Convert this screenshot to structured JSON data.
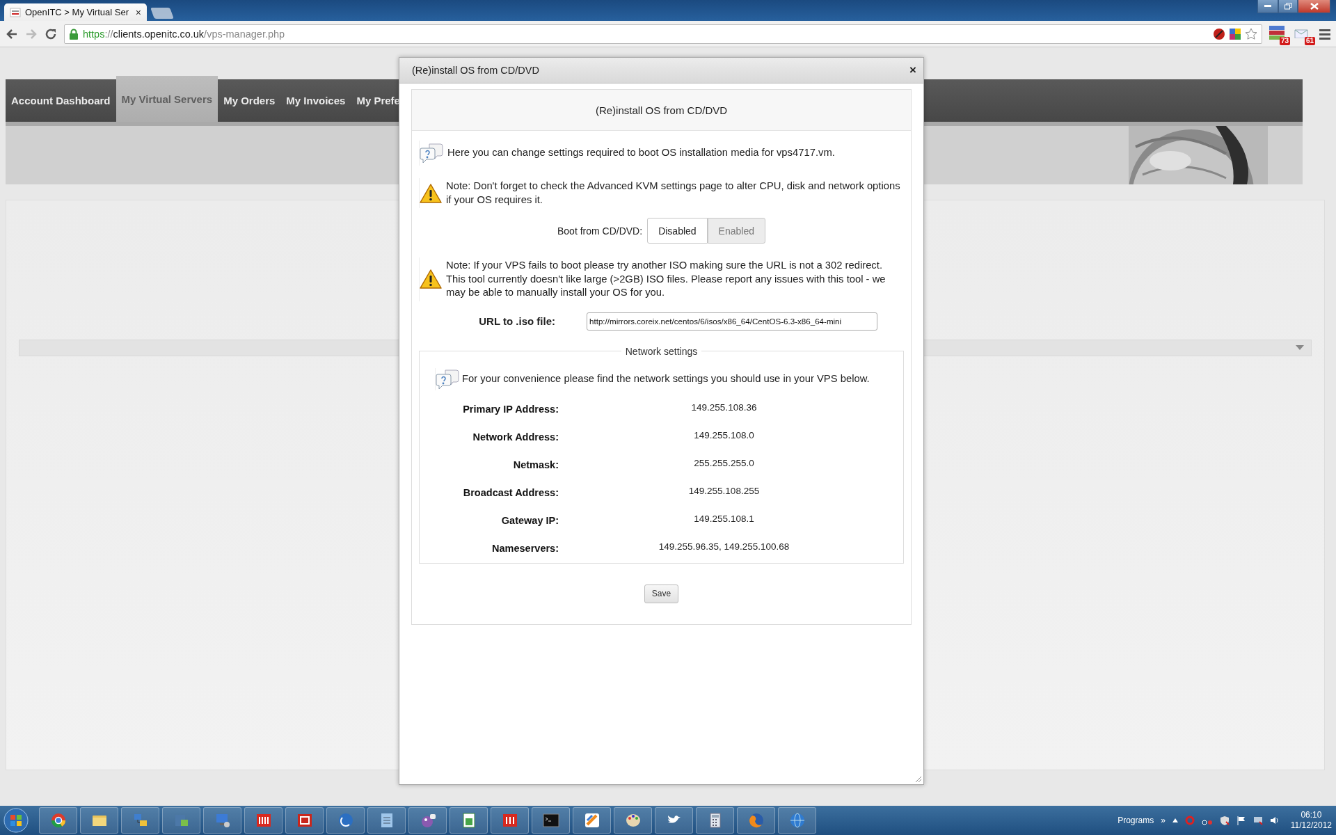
{
  "browser": {
    "tab": {
      "title": "OpenITC > My Virtual Ser",
      "close": "×"
    },
    "address": {
      "scheme": "https",
      "separator": "://",
      "host": "clients.openitc.co.uk",
      "path": "/vps-manager.php"
    },
    "extension_badges": [
      "73",
      "61"
    ]
  },
  "nav": {
    "items": [
      {
        "label": "Account Dashboard",
        "selected": false
      },
      {
        "label": "My Virtual Servers",
        "selected": true
      },
      {
        "label": "My Orders",
        "selected": false
      },
      {
        "label": "My Invoices",
        "selected": false
      },
      {
        "label": "My Prefe",
        "selected": false
      }
    ]
  },
  "dialog": {
    "title": "(Re)install OS from CD/DVD",
    "close": "×",
    "heading": "(Re)install OS from CD/DVD",
    "sections": [
      {
        "kind": "info",
        "text": "Here you can change settings required to boot OS installation media for vps4717.vm."
      },
      {
        "kind": "warning",
        "text": "Note: Don't forget to check the Advanced KVM settings page to alter CPU, disk and network options if your OS requires it."
      },
      {
        "kind": "toggle",
        "label": "Boot from CD/DVD:",
        "options": [
          {
            "label": "Disabled",
            "selected": true
          },
          {
            "label": "Enabled",
            "selected": false
          }
        ]
      },
      {
        "kind": "warning",
        "text": "Note: If your VPS fails to boot please try another ISO making sure the URL is not a 302 redirect. This tool currently doesn't like large (>2GB) ISO files. Please report any issues with this tool - we may be able to manually install your OS for you."
      },
      {
        "kind": "field",
        "label": "URL to .iso file:",
        "value": "http://mirrors.coreix.net/centos/6/isos/x86_64/CentOS-6.3-x86_64-mini"
      }
    ],
    "network": {
      "legend": "Network settings",
      "info": "For your convenience please find the network settings you should use in your VPS below.",
      "rows": [
        {
          "label": "Primary IP Address:",
          "value": "149.255.108.36"
        },
        {
          "label": "Network Address:",
          "value": "149.255.108.0"
        },
        {
          "label": "Netmask:",
          "value": "255.255.255.0"
        },
        {
          "label": "Broadcast Address:",
          "value": "149.255.108.255"
        },
        {
          "label": "Gateway IP:",
          "value": "149.255.108.1"
        },
        {
          "label": "Nameservers:",
          "value": "149.255.96.35, 149.255.100.68"
        }
      ]
    },
    "save": "Save"
  },
  "taskbar": {
    "programs": "Programs",
    "chevron": "»",
    "time": "06:10",
    "date": "11/12/2012"
  }
}
